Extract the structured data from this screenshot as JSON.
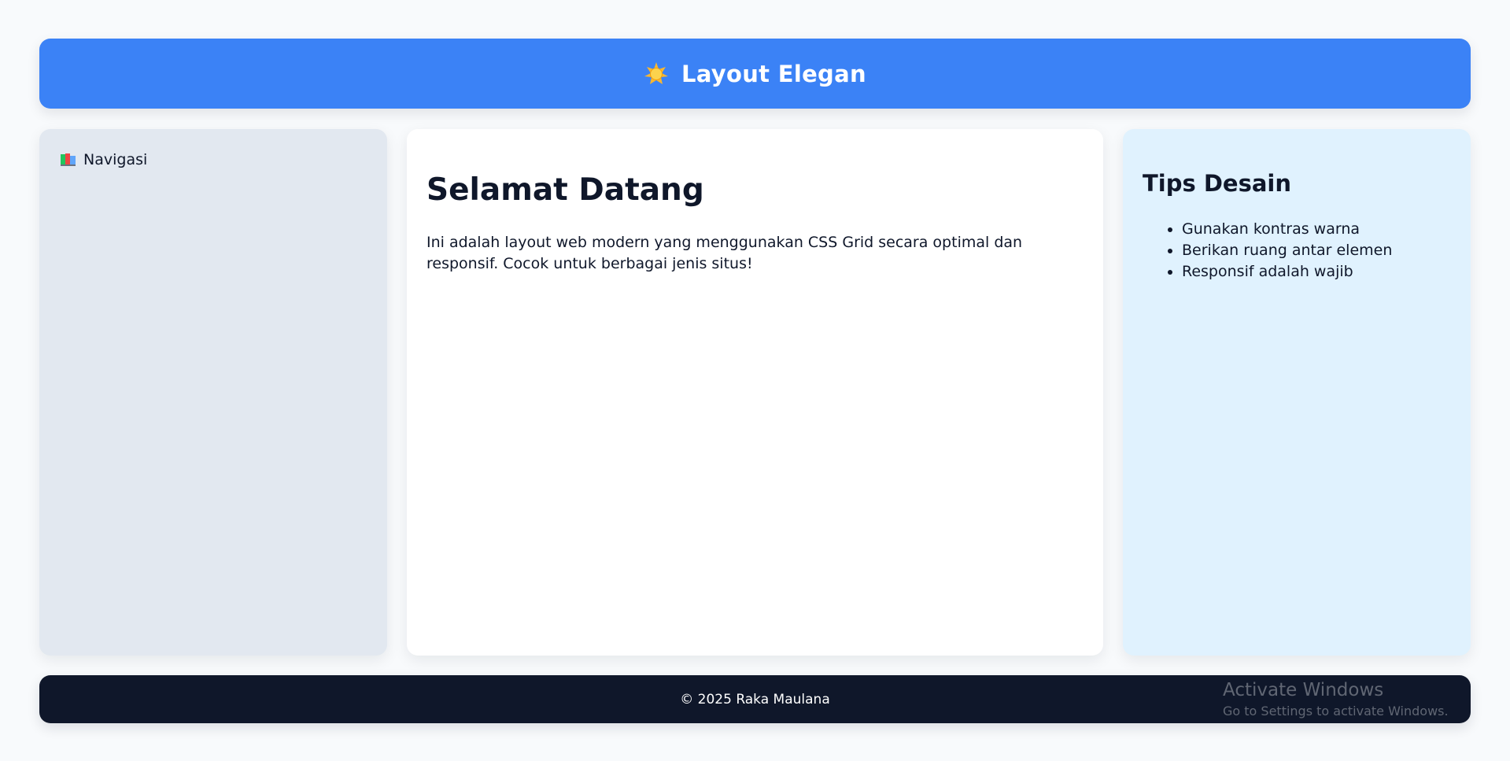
{
  "header": {
    "icon": "sun-icon",
    "title": "Layout Elegan"
  },
  "sidebar": {
    "nav_icon": "books-icon",
    "nav_label": "Navigasi"
  },
  "main": {
    "title": "Selamat Datang",
    "text": "Ini adalah layout web modern yang menggunakan CSS Grid secara optimal dan responsif. Cocok untuk berbagai jenis situs!"
  },
  "aside": {
    "title": "Tips Desain",
    "tips": [
      "Gunakan kontras warna",
      "Berikan ruang antar elemen",
      "Responsif adalah wajib"
    ]
  },
  "footer": {
    "text": "© 2025 Raka Maulana"
  },
  "watermark": {
    "title": "Activate Windows",
    "subtitle": "Go to Settings to activate Windows."
  },
  "colors": {
    "background": "#f8fafc",
    "header": "#3b82f6",
    "sidebar": "#e2e8f0",
    "main": "#ffffff",
    "aside": "#e0f2fe",
    "footer": "#0f172a",
    "text": "#0f172a"
  }
}
